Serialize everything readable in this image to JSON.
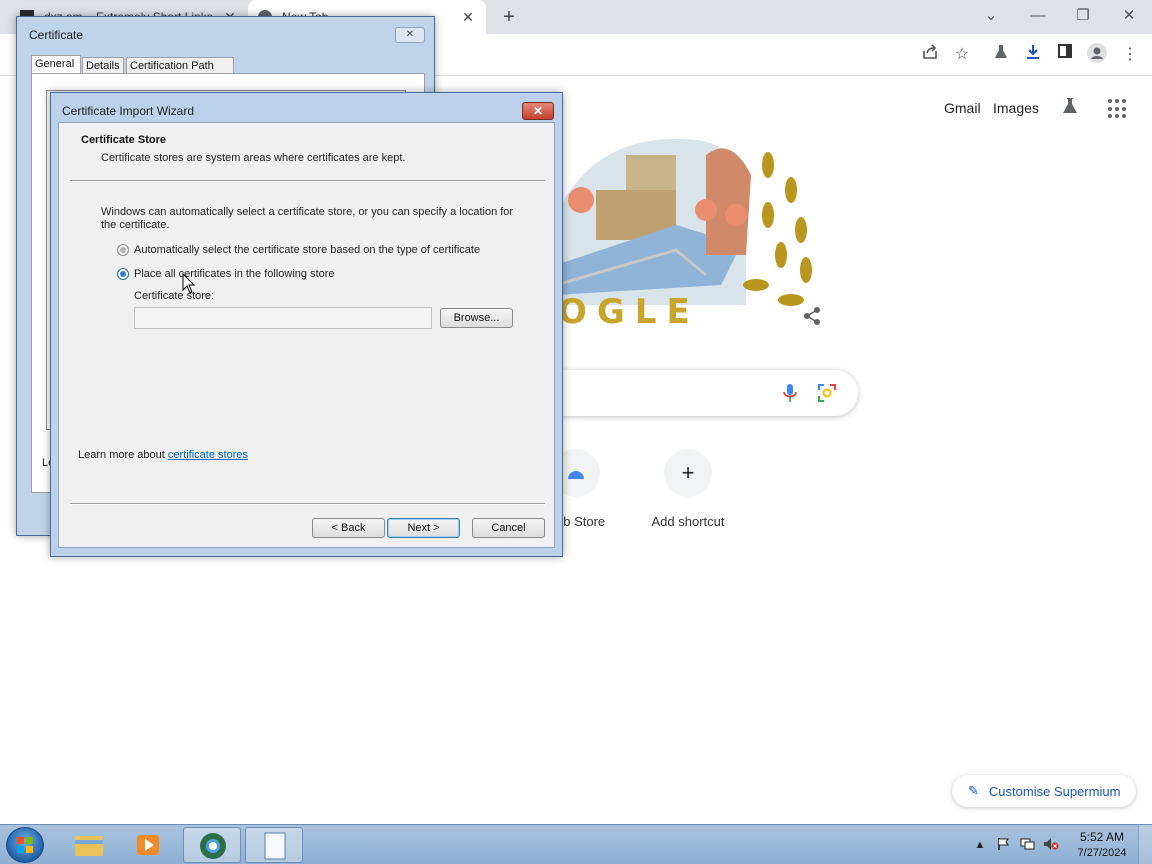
{
  "browser": {
    "tabs": [
      {
        "title": "dxz.am – Extremely Short Links",
        "close": "✕"
      },
      {
        "title": "New Tab",
        "close": "✕"
      }
    ],
    "new_tab_symbol": "+",
    "window_controls": {
      "chevron": "⌄",
      "minimize": "—",
      "restore": "❐",
      "close": "✕"
    },
    "toolbar_icons": [
      "share-icon",
      "star-icon",
      "labs-icon",
      "download-icon",
      "side-panel-icon",
      "profile-icon",
      "menu-icon"
    ]
  },
  "ntp": {
    "gmail": "Gmail",
    "images": "Images",
    "doodle_text": "OGLE",
    "shortcuts": [
      {
        "label": "eb Store",
        "icon": "web-store-icon"
      },
      {
        "label": "Add shortcut",
        "symbol": "+"
      }
    ],
    "customise_label": "Customise Supermium"
  },
  "certificate_window": {
    "title": "Certificate",
    "close_symbol": "✕",
    "tabs": [
      "General",
      "Details",
      "Certification Path"
    ],
    "active_tab": "General",
    "partial_text": "Le"
  },
  "wizard": {
    "title": "Certificate Import Wizard",
    "close_symbol": "✕",
    "header_title": "Certificate Store",
    "header_subtitle": "Certificate stores are system areas where certificates are kept.",
    "intro": "Windows can automatically select a certificate store, or you can specify a location for the certificate.",
    "options": [
      {
        "label": "Automatically select the certificate store based on the type of certificate",
        "checked": false,
        "enabled": false
      },
      {
        "label": "Place all certificates in the following store",
        "checked": true,
        "enabled": true
      }
    ],
    "store_label": "Certificate store:",
    "store_value": "",
    "browse_label": "Browse...",
    "learn_prefix": "Learn more about ",
    "learn_link": "certificate stores",
    "back_label": "< Back",
    "next_label": "Next >",
    "cancel_label": "Cancel"
  },
  "taskbar": {
    "apps": [
      "explorer-icon",
      "media-player-icon",
      "browser-icon",
      "notepad-icon"
    ],
    "tray_up": "▲",
    "time": "5:52 AM",
    "date": "7/27/2024"
  },
  "colors": {
    "wizard_frame": "#bcd2ec",
    "link": "#0066cc",
    "customise_text": "#1a57b9"
  }
}
